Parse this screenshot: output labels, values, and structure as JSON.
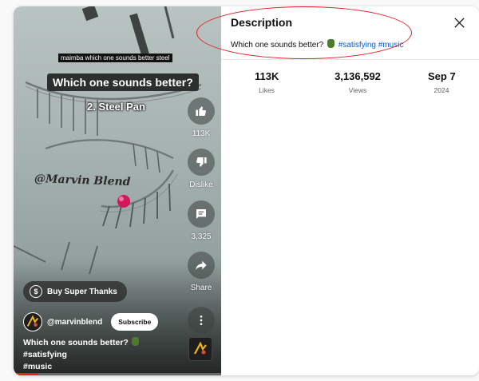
{
  "video": {
    "caption_small": "maimba which one sounds better steel",
    "caption_big": "Which one sounds better?",
    "caption_sub": "2. Steel Pan",
    "watermark": "@Marvin Blend",
    "actions": {
      "like_count": "113K",
      "dislike_label": "Dislike",
      "comment_count": "3,325",
      "share_label": "Share"
    },
    "super_thanks_label": "Buy Super Thanks",
    "channel_name": "@marvinblend",
    "subscribe_label": "Subscribe",
    "title_text": "Which one sounds better?",
    "title_tag1": "#satisfying",
    "title_tag2": "#music",
    "progress": 0.12
  },
  "description": {
    "heading": "Description",
    "text": "Which one sounds better?",
    "tag1": "#satisfying",
    "tag2": "#music",
    "stats": [
      {
        "value": "113K",
        "label": "Likes"
      },
      {
        "value": "3,136,592",
        "label": "Views"
      },
      {
        "value": "Sep 7",
        "label": "2024"
      }
    ]
  },
  "colors": {
    "accent_link": "#065fd4",
    "annotation": "#e0242a",
    "progress": "#e62117"
  }
}
